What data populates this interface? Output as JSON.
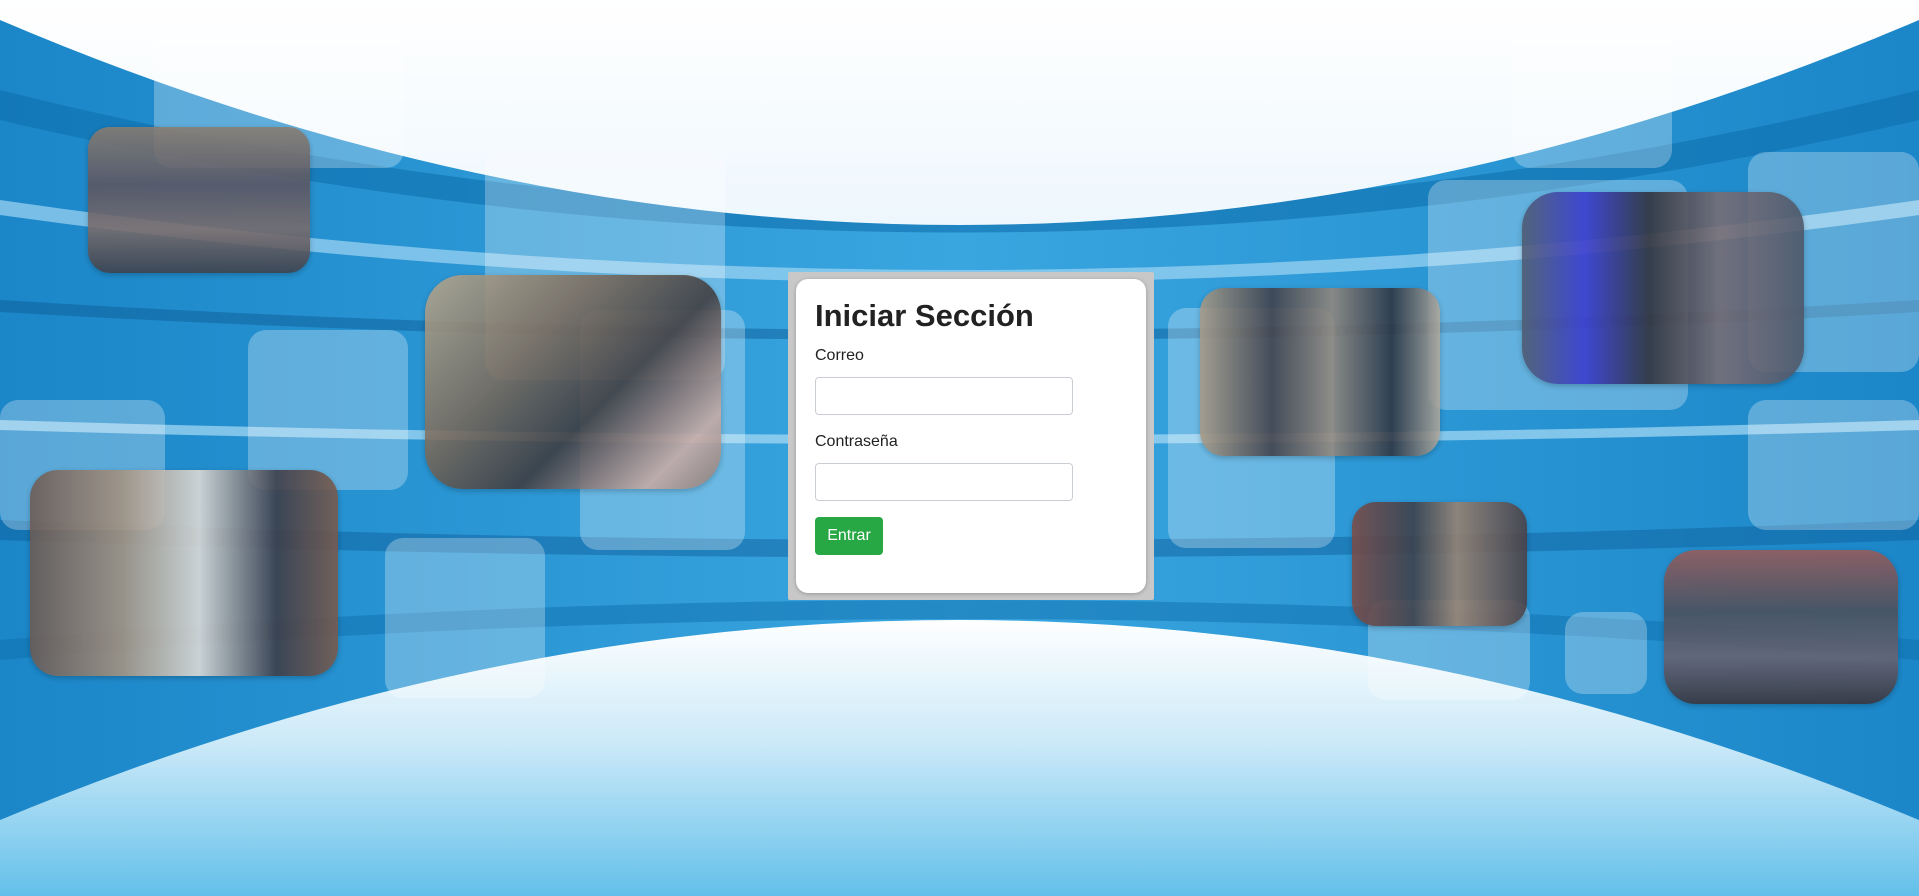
{
  "login": {
    "title": "Iniciar Sección",
    "email_label": "Correo",
    "email_value": "",
    "password_label": "Contraseña",
    "password_value": "",
    "submit_label": "Entrar"
  },
  "colors": {
    "accent_button": "#28a745",
    "background_blue": "#1f8fd0"
  },
  "background": {
    "photos": [
      "ceremony-group-photo",
      "handshake-photo",
      "panel-table-photo",
      "officials-table-photo",
      "oath-group-photo",
      "panel-with-flag-photo",
      "large-group-photo"
    ]
  }
}
